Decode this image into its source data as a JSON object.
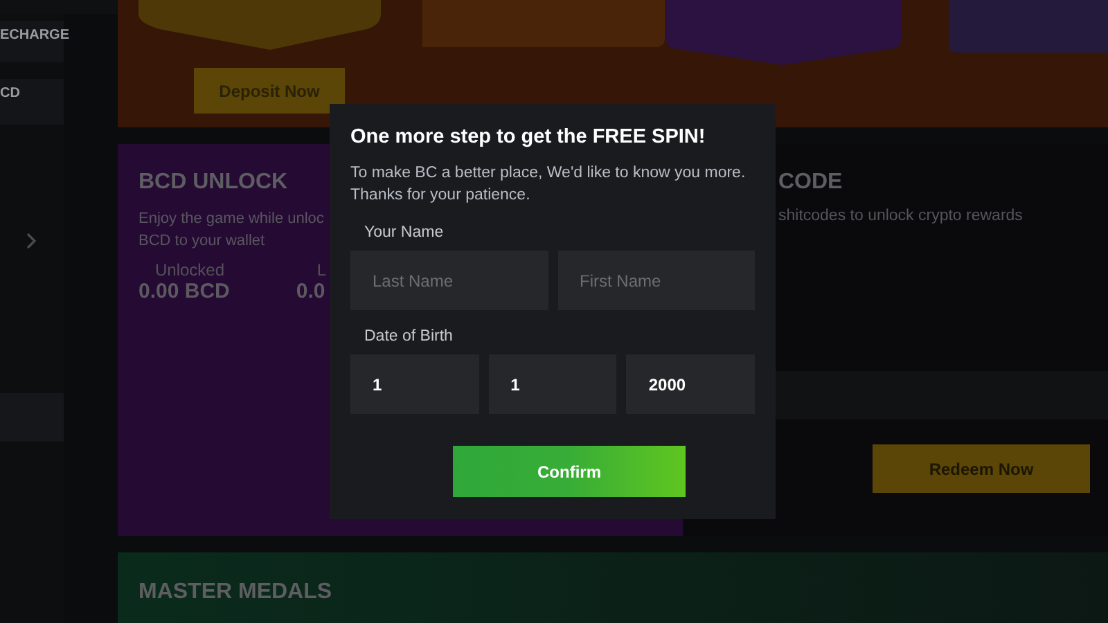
{
  "sidebar": {
    "items": [
      {
        "label": "ECHARGE"
      },
      {
        "label": "CD"
      }
    ]
  },
  "deposit_banner": {
    "button": "Deposit Now"
  },
  "bcd_unlock": {
    "title": "BCD UNLOCK",
    "description_lines": [
      "Enjoy the game while unloc",
      "BCD to your wallet"
    ],
    "stats": [
      {
        "label": "Unlocked",
        "value": "0.00 BCD"
      },
      {
        "label": "L",
        "value": "0.0"
      }
    ]
  },
  "code_card": {
    "title": "CODE",
    "description": "shitcodes to unlock crypto rewards",
    "button": "Redeem Now"
  },
  "master_medals": {
    "title": "MASTER MEDALS"
  },
  "modal": {
    "title": "One more step to get the FREE SPIN!",
    "message_lines": [
      "To make BC a better place, We'd like to know you more.",
      "Thanks for your patience."
    ],
    "name_label": "Your Name",
    "name_fields": [
      {
        "placeholder": "Last Name"
      },
      {
        "placeholder": "First Name"
      }
    ],
    "dob_label": "Date of Birth",
    "dob_fields": [
      {
        "value": "1"
      },
      {
        "value": "1"
      },
      {
        "value": "2000"
      }
    ],
    "confirm_button": "Confirm"
  }
}
